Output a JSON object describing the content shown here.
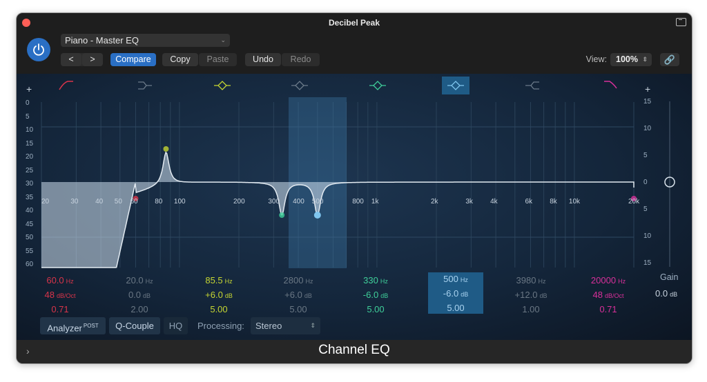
{
  "window": {
    "title": "Decibel Peak"
  },
  "header": {
    "preset": "Piano - Master EQ",
    "prev_label": "<",
    "next_label": ">",
    "compare_label": "Compare",
    "copy_label": "Copy",
    "paste_label": "Paste",
    "undo_label": "Undo",
    "redo_label": "Redo",
    "view_label": "View:",
    "view_value": "100%"
  },
  "graph": {
    "left_scale": [
      "0",
      "5",
      "10",
      "15",
      "20",
      "25",
      "30",
      "35",
      "40",
      "45",
      "50",
      "55",
      "60"
    ],
    "right_scale": [
      "15",
      "10",
      "5",
      "0",
      "5",
      "10",
      "15"
    ],
    "freq_labels": [
      "20",
      "30",
      "40",
      "50",
      "60",
      "80",
      "100",
      "200",
      "300",
      "400",
      "500",
      "800",
      "1k",
      "2k",
      "3k",
      "4k",
      "6k",
      "8k",
      "10k",
      "20k"
    ],
    "plus_label": "+"
  },
  "bands": [
    {
      "name": "low-cut",
      "freq": "60.0",
      "freq_unit": "Hz",
      "gain": "48",
      "gain_unit": "dB/Oct",
      "q": "0.71",
      "color": "#d9344a",
      "active": true
    },
    {
      "name": "low-shelf",
      "freq": "20.0",
      "freq_unit": "Hz",
      "gain": "0.0",
      "gain_unit": "dB",
      "q": "2.00",
      "color": "#6c7b8a",
      "active": false
    },
    {
      "name": "parametric-1",
      "freq": "85.5",
      "freq_unit": "Hz",
      "gain": "+6.0",
      "gain_unit": "dB",
      "q": "5.00",
      "color": "#c6d632",
      "active": true
    },
    {
      "name": "parametric-2",
      "freq": "2800",
      "freq_unit": "Hz",
      "gain": "+6.0",
      "gain_unit": "dB",
      "q": "5.00",
      "color": "#6c7b8a",
      "active": false
    },
    {
      "name": "parametric-3",
      "freq": "330",
      "freq_unit": "Hz",
      "gain": "-6.0",
      "gain_unit": "dB",
      "q": "5.00",
      "color": "#3fcf9a",
      "active": true
    },
    {
      "name": "parametric-4",
      "freq": "500",
      "freq_unit": "Hz",
      "gain": "-6.0",
      "gain_unit": "dB",
      "q": "5.00",
      "color": "#7fc6ef",
      "active": true,
      "selected": true
    },
    {
      "name": "high-shelf",
      "freq": "3980",
      "freq_unit": "Hz",
      "gain": "+12.0",
      "gain_unit": "dB",
      "q": "1.00",
      "color": "#6c7b8a",
      "active": false
    },
    {
      "name": "high-cut",
      "freq": "20000",
      "freq_unit": "Hz",
      "gain": "48",
      "gain_unit": "dB/Oct",
      "q": "0.71",
      "color": "#d8309a",
      "active": true
    }
  ],
  "gain": {
    "label": "Gain",
    "value": "0.0",
    "unit": "dB"
  },
  "bottom": {
    "analyzer_label": "Analyzer",
    "analyzer_sup": "POST",
    "qcouple_label": "Q-Couple",
    "hq_label": "HQ",
    "processing_label": "Processing:",
    "processing_value": "Stereo"
  },
  "footer": {
    "plugin_name": "Channel EQ"
  }
}
